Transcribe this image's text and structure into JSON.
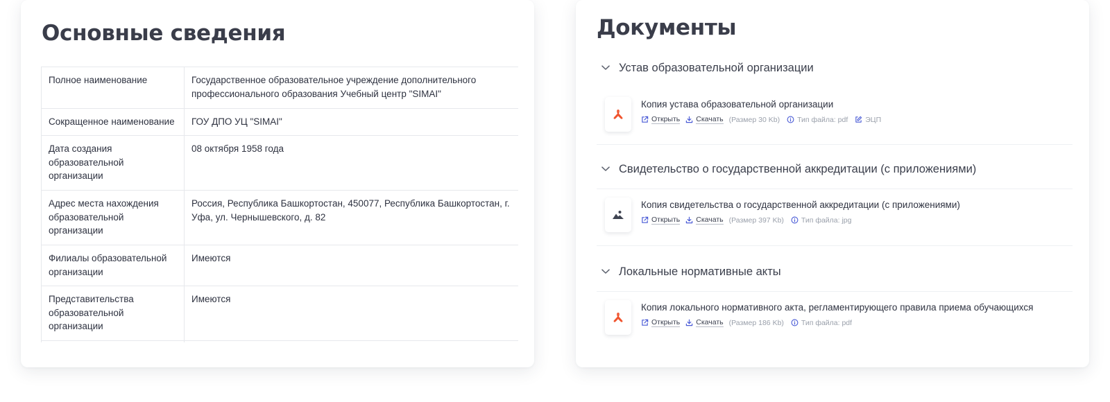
{
  "basic_info": {
    "title": "Основные сведения",
    "rows": [
      {
        "key": "Полное наименование",
        "value": "Государственное образовательное учреждение дополнительного профессионального образования Учебный центр \"SIMAI\""
      },
      {
        "key": "Сокращенное наименование",
        "value": "ГОУ ДПО УЦ \"SIMAI\""
      },
      {
        "key": "Дата создания образовательной организации",
        "value": "08 октября 1958 года"
      },
      {
        "key": "Адрес места нахождения образовательной организации",
        "value": "Россия, Республика Башкортостан, 450077, Республика Башкортостан, г. Уфа, ул. Чернышевского, д. 82"
      },
      {
        "key": "Филиалы образовательной организации",
        "value": "Имеются"
      },
      {
        "key": "Представительства образовательной организации",
        "value": "Имеются"
      }
    ]
  },
  "documents": {
    "title": "Документы",
    "sections": [
      {
        "heading": "Устав образовательной организации",
        "doc": {
          "title": "Копия устава образовательной организации",
          "open_label": "Открыть",
          "download_label": "Скачать",
          "size": "(Размер 30 Kb)",
          "type": "Тип файла: pdf",
          "ecp": "ЭЦП",
          "icon": "pdf-icon"
        }
      },
      {
        "heading": "Свидетельство о государственной аккредитации (с приложениями)",
        "doc": {
          "title": "Копия свидетельства о государственной аккредитации (с приложениями)",
          "open_label": "Открыть",
          "download_label": "Скачать",
          "size": "(Размер 397 Kb)",
          "type": "Тип файла: jpg",
          "icon": "image-icon"
        }
      },
      {
        "heading": "Локальные нормативные акты",
        "doc": {
          "title": "Копия локального нормативного акта, регламентирующего правила приема обучающихся",
          "open_label": "Открыть",
          "download_label": "Скачать",
          "size": "(Размер 186 Kb)",
          "type": "Тип файла: pdf",
          "icon": "pdf-icon"
        }
      }
    ]
  },
  "colors": {
    "accent": "#4a5bd6",
    "pdf": "#f0542e",
    "text": "#2b2f3a",
    "muted": "#9aa0ab"
  }
}
